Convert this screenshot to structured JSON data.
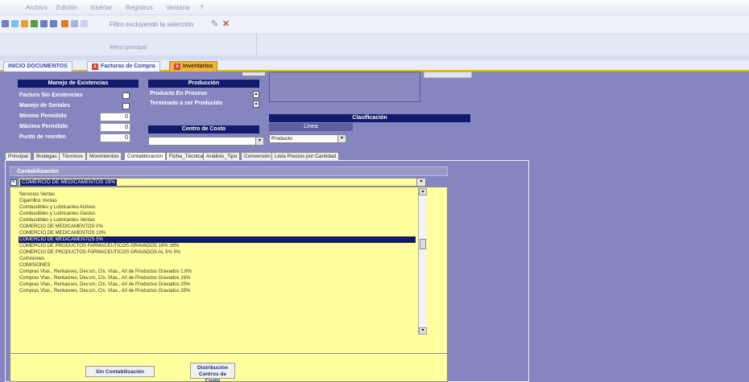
{
  "menu": {
    "items": [
      "Archivo",
      "Edición",
      "Insertar",
      "Registros",
      "Ventana",
      "?"
    ]
  },
  "toolbar": {
    "text": "Filtro excluyendo la selección"
  },
  "section": {
    "label": "Menú principal"
  },
  "doc_tabs": [
    "INICIO DOCUMENTOS",
    "Facturas de Compra",
    "Inventarios"
  ],
  "manejo": {
    "header": "Manejo de Existencias",
    "items": [
      {
        "label": "Factura Sin Existencias"
      },
      {
        "label": "Manejo de Seriales"
      },
      {
        "label": "Mínimo Permitido",
        "value": "0"
      },
      {
        "label": "Máximo Permitido",
        "value": "0"
      },
      {
        "label": "Punto de reorden",
        "value": "0"
      }
    ]
  },
  "produccion": {
    "header": "Producción",
    "items": [
      {
        "label": "Producto En Proceso"
      },
      {
        "label": "Terminado a ser Producido"
      }
    ]
  },
  "centro_costo": {
    "header": "Centro de Costo",
    "value": ""
  },
  "clasificacion": {
    "header": "Clasificación",
    "sub_header": "Línea",
    "value": "Producto"
  },
  "sub_tabs": [
    "Principal",
    "Bodegas",
    "Técnicos",
    "Movimientos",
    "Contabilización",
    "Ficha_Técnica",
    "Análisis_Tipo",
    "Conversión",
    "Lista Precios por Cantidad"
  ],
  "contabilizacion": {
    "header": "Contabilización",
    "selected_value": "COMERCIO DE MEDICAMENTOS 19%",
    "options": [
      "Servicios Ventas",
      "Cigarrillos Ventas",
      "Combustibles y Lubricantes Activos",
      "Combustibles y Lubricantes Gastos",
      "Combustibles y Lubricantes Ventas",
      "COMERCIO DE MEDICAMENTOS 0%",
      "COMERCIO DE MEDICAMENTOS 10%",
      "COMERCIO DE MEDICAMENTOS 5%",
      "COMERCIO DE PRODUCTOS FARMACEUTICOS GRAVADOS 16% 16%",
      "COMERCIO DE PRODUCTOS FARMACEUTICOS GRAVADOS AL 5% 5%",
      "Comisiones",
      "COMISIONES",
      "Compras Vtas., Rentasnes, Dev.x/c, Cls. Vtas., A/I de Productos Gravados 1.6%",
      "Compras Vtas., Rentasnes, Dev.x/c, Cls. Vtas., A/I de Productos Gravados 16%",
      "Compras Vtas., Rentasnes, Dev.x/c, Cls. Vtas., A/I de Productos Gravados 25%",
      "Compras Vtas., Rentasnes, Dev.x/c, Cls. Vtas., A/I de Productos Gravados 35%"
    ],
    "selected_index": 7
  },
  "buttons": {
    "sin_contabilizacion": "Sin Contabilización",
    "distribucion": "Distribución Centros de Costo"
  },
  "colors": {
    "dark_header": "#121b6b",
    "background": "#8585bf",
    "list_bg": "#ffff9e",
    "active_tab": "#f2b33a"
  }
}
